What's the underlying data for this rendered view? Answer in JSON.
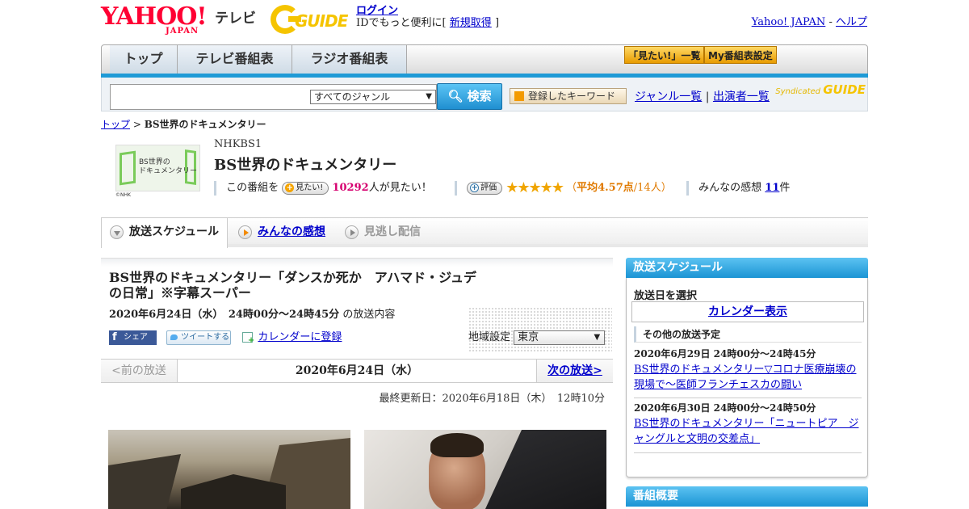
{
  "header": {
    "logo_text": "YAHOO!",
    "logo_sub": "JAPAN",
    "service_label": "テレビ",
    "gguide_logo": "GUIDE",
    "login_label": "ログイン",
    "login_hint_prefix": "IDでもっと便利に[",
    "register_label": "新規取得",
    "login_hint_suffix": "]",
    "yahoo_japan_link": "Yahoo! JAPAN",
    "link_separator": "-",
    "help_link": "ヘルプ"
  },
  "nav": {
    "tabs": [
      "トップ",
      "テレビ番組表",
      "ラジオ番組表"
    ],
    "mitai_list": "「見たい!」一覧",
    "my_schedule": "My番組表設定"
  },
  "search": {
    "placeholder": "",
    "genre_selected": "すべてのジャンル",
    "search_button": "検索",
    "keyword_button": "登録したキーワード",
    "genre_list_link": "ジャンル一覧",
    "divider": "|",
    "cast_list_link": "出演者一覧",
    "syndicated_label": "Syndicated",
    "syndicated_logo": "GUIDE"
  },
  "breadcrumb": {
    "home": "トップ",
    "sep": ">",
    "current": "BS世界のドキュメンタリー"
  },
  "program": {
    "thumbnail_text_1": "BS世界の",
    "thumbnail_text_2": "ドキュメンタリー",
    "thumbnail_credit": "©NHK",
    "channel": "NHKBS1",
    "title": "BS世界のドキュメンタリー",
    "mitai_prefix": "この番組を",
    "mitai_pill": "見たい!",
    "mitai_count": "10292",
    "mitai_suffix": "人が見たい！",
    "rating_pill": "評価",
    "stars_value": 4.57,
    "rating_prefix": "（",
    "rating_avg": "平均4.57点",
    "rating_count": "/14人）",
    "impressions_label": "みんなの感想",
    "impressions_count": "11",
    "impressions_unit": "件"
  },
  "subtabs": {
    "schedule": "放送スケジュール",
    "impressions": "みんなの感想",
    "catchup": "見逃し配信"
  },
  "episode": {
    "title": "BS世界のドキュメンタリー「ダンスか死か　アハマド・ジュデの日常」※字幕スーパー",
    "date": "2020年6月24日（水）　24時00分～24時45分",
    "date_suffix": "の放送内容",
    "share_fb": "シェア",
    "share_tw": "ツイートする",
    "calendar_register": "カレンダーに登録",
    "region_label": "地域設定",
    "region_selected": "東京"
  },
  "pager": {
    "prev": "<前の放送",
    "current": "2020年6月24日（水）",
    "next": "次の放送>"
  },
  "updated": "最終更新日：2020年6月18日（木）　12時10分",
  "sidebar": {
    "schedule_head": "放送スケジュール",
    "select_date": "放送日を選択",
    "calendar_btn": "カレンダー表示",
    "other_head": "その他の放送予定",
    "items": [
      {
        "date": "2020年6月29日 24時00分～24時45分",
        "title": "BS世界のドキュメンタリー▽コロナ医療崩壊の現場で～医師フランチェスカの闘い"
      },
      {
        "date": "2020年6月30日 24時00分～24時50分",
        "title": "BS世界のドキュメンタリー「ニュートピア　ジャングルと文明の交差点」"
      }
    ],
    "overview_head": "番組概要"
  },
  "colors": {
    "accent_blue": "#1f9ad6",
    "yahoo_red": "#ff0033",
    "gguide_yellow": "#f5c400",
    "mitai_pink": "#d6006f",
    "star_orange": "#f0a500"
  }
}
